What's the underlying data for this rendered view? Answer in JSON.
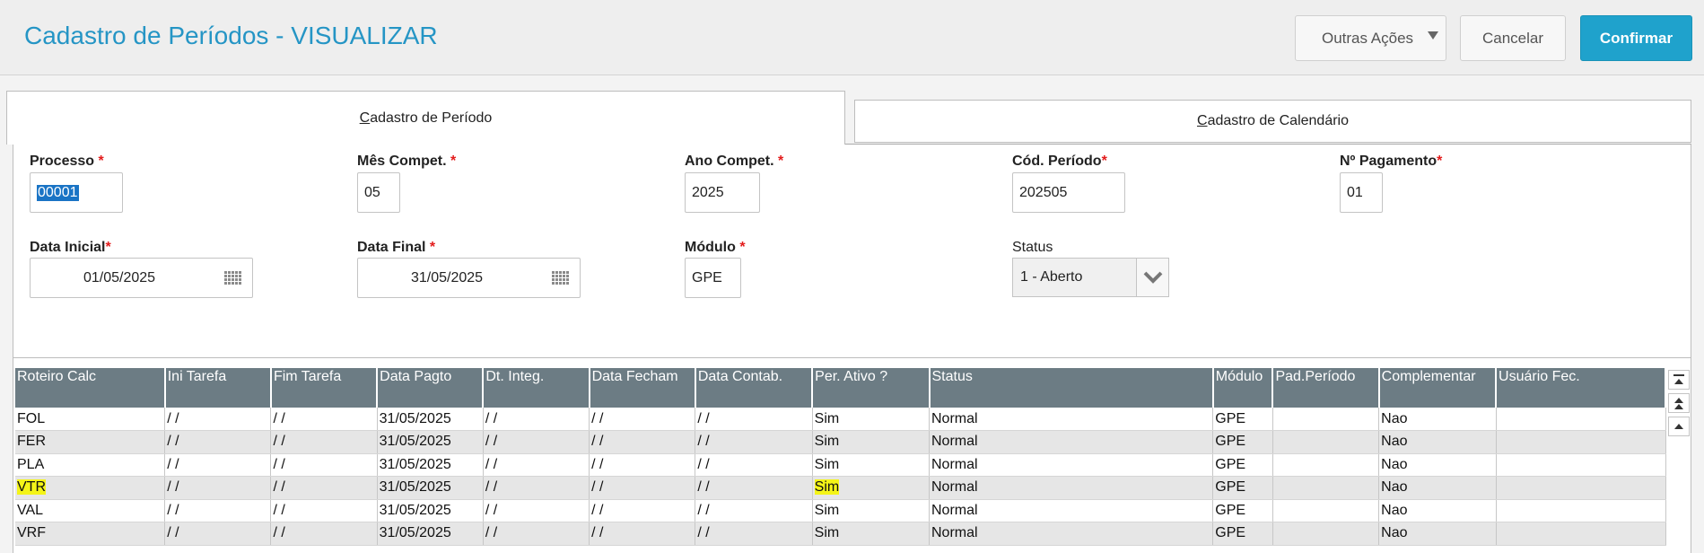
{
  "header": {
    "title": "Cadastro de Períodos - VISUALIZAR",
    "buttons": {
      "outras_acoes": "Outras Ações",
      "cancelar": "Cancelar",
      "confirmar": "Confirmar"
    }
  },
  "tabs": [
    {
      "first_letter": "C",
      "rest": "adastro de Período",
      "active": true
    },
    {
      "first_letter": "C",
      "rest": "adastro de Calendário",
      "active": false
    }
  ],
  "form": {
    "processo": {
      "label": "Processo ",
      "required_mark": "*",
      "value": "00001"
    },
    "mes_compet": {
      "label": "Mês Compet. ",
      "required_mark": "*",
      "value": "05"
    },
    "ano_compet": {
      "label": "Ano Compet. ",
      "required_mark": "*",
      "value": "2025"
    },
    "cod_periodo": {
      "label": "Cód. Período",
      "required_mark": "*",
      "value": "202505"
    },
    "n_pagamento": {
      "label": "Nº Pagamento",
      "required_mark": "*",
      "value": "01"
    },
    "data_inicial": {
      "label": "Data Inicial",
      "required_mark": "*",
      "value": "01/05/2025"
    },
    "data_final": {
      "label": "Data Final ",
      "required_mark": "*",
      "value": "31/05/2025"
    },
    "modulo": {
      "label": "Módulo ",
      "required_mark": "*",
      "value": "GPE"
    },
    "status": {
      "label": "Status",
      "value": "1 - Aberto"
    }
  },
  "grid": {
    "columns": [
      "Roteiro Calc",
      "Ini Tarefa",
      "Fim Tarefa",
      "Data Pagto",
      "Dt. Integ.",
      "Data Fecham",
      "Data Contab.",
      "Per. Ativo ?",
      "Status",
      "Módulo",
      "Pad.Período",
      "Complementar",
      "Usuário Fec."
    ],
    "rows": [
      [
        "FOL",
        " / /",
        " / /",
        "31/05/2025",
        " / /",
        " / /",
        " / /",
        "Sim",
        "Normal",
        "GPE",
        "",
        "Nao",
        ""
      ],
      [
        "FER",
        " / /",
        " / /",
        "31/05/2025",
        " / /",
        " / /",
        " / /",
        "Sim",
        "Normal",
        "GPE",
        "",
        "Nao",
        ""
      ],
      [
        "PLA",
        " / /",
        " / /",
        "31/05/2025",
        " / /",
        " / /",
        " / /",
        "Sim",
        "Normal",
        "GPE",
        "",
        "Nao",
        ""
      ],
      [
        "VTR",
        " / /",
        " / /",
        "31/05/2025",
        " / /",
        " / /",
        " / /",
        "Sim",
        "Normal",
        "GPE",
        "",
        "Nao",
        ""
      ],
      [
        "VAL",
        " / /",
        " / /",
        "31/05/2025",
        " / /",
        " / /",
        " / /",
        "Sim",
        "Normal",
        "GPE",
        "",
        "Nao",
        ""
      ],
      [
        "VRF",
        " / /",
        " / /",
        "31/05/2025",
        " / /",
        " / /",
        " / /",
        "Sim",
        "Normal",
        "GPE",
        "",
        "Nao",
        ""
      ]
    ],
    "highlighted_row": 3,
    "highlight_color": "#f4f418",
    "header_color": "#6c7c84"
  },
  "colors": {
    "title": "#2595c5",
    "confirm_button": "#1fa2cc",
    "required_mark": "#e31b1b"
  },
  "icons": [
    "caret-down-icon",
    "calendar-icon",
    "chevron-down-icon",
    "scroll-top-icon",
    "scroll-up-page-icon",
    "scroll-up-icon"
  ]
}
